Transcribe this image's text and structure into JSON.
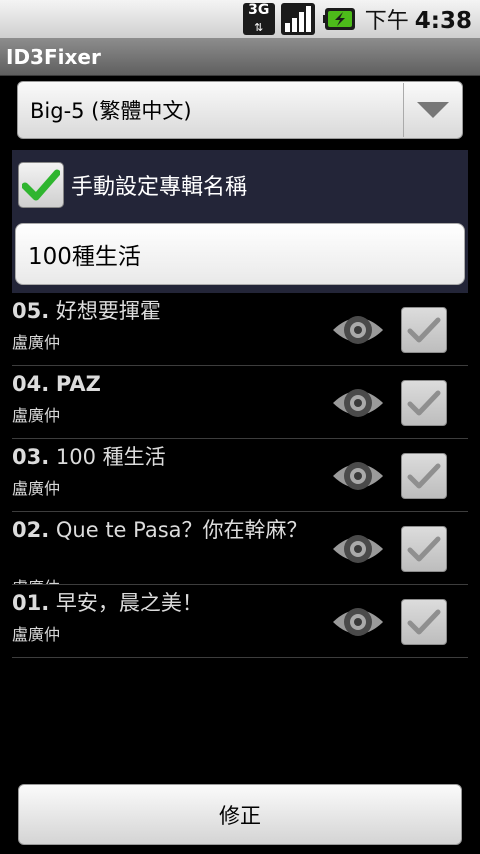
{
  "status_bar": {
    "network": "3G",
    "network_arrows": "⇅",
    "ampm": "下午",
    "time": "4:38",
    "icons": [
      "network-3g-icon",
      "signal-icon",
      "battery-charging-icon"
    ]
  },
  "app": {
    "title": "ID3Fixer"
  },
  "encoding": {
    "selected": "Big-5 (繁體中文)"
  },
  "album": {
    "manual_label": "手動設定專輯名稱",
    "manual_checked": true,
    "name_value": "100種生活"
  },
  "tracks": [
    {
      "number": "05.",
      "title": "好想要揮霍",
      "artist": "盧廣仲",
      "checked": true
    },
    {
      "number": "04.",
      "title": "PAZ",
      "artist": "盧廣仲",
      "checked": true
    },
    {
      "number": "03.",
      "title": "100 種生活",
      "artist": "盧廣仲",
      "checked": true
    },
    {
      "number": "02.",
      "title": "Que te Pasa？你在幹麻？",
      "artist": "盧廣仲",
      "checked": true
    },
    {
      "number": "01.",
      "title": "早安，晨之美！",
      "artist": "盧廣仲",
      "checked": true
    }
  ],
  "actions": {
    "fix_label": "修正"
  },
  "colors": {
    "accent_check": "#2fb52f",
    "panel_bg": "#232538",
    "title_bar": "#6f6f6f"
  }
}
